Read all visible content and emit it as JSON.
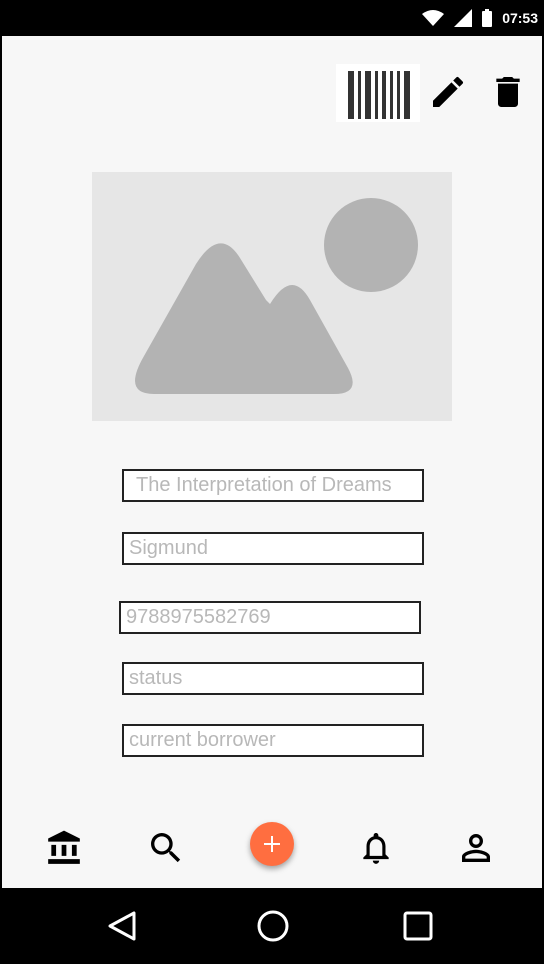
{
  "status_bar": {
    "time": "07:53",
    "icons": [
      "wifi-icon",
      "signal-icon",
      "battery-icon"
    ]
  },
  "toolbar": {
    "icons": [
      "barcode-icon",
      "edit-icon",
      "delete-icon"
    ]
  },
  "book": {
    "cover_icon": "image-placeholder-icon",
    "fields": {
      "title": {
        "value": "The Interpretation of Dreams"
      },
      "author": {
        "value": "Sigmund"
      },
      "isbn": {
        "value": "9788975582769"
      },
      "status": {
        "placeholder": "status"
      },
      "borrower": {
        "placeholder": "current borrower"
      }
    }
  },
  "bottom_nav": {
    "items": [
      "library-icon",
      "search-icon",
      "add-icon",
      "notifications-icon",
      "profile-icon"
    ],
    "fab_color": "#ff6e40"
  },
  "system_nav": {
    "items": [
      "back-icon",
      "home-icon",
      "recents-icon"
    ]
  }
}
